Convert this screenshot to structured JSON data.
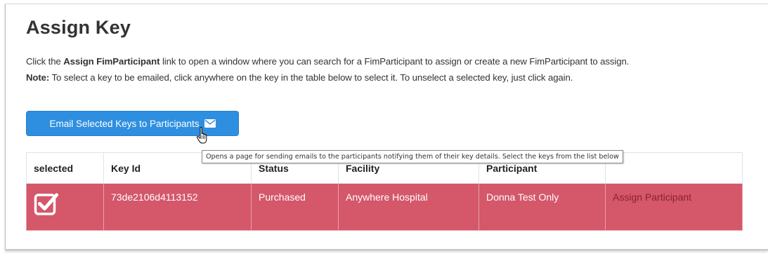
{
  "page": {
    "title": "Assign Key",
    "intro": {
      "prefix": "Click the ",
      "link_label": "Assign FimParticipant",
      "suffix": " link to open a window where you can search for a FimParticipant to assign or create a new FimParticipant to assign."
    },
    "note": {
      "label": "Note:",
      "text": " To select a key to be emailed, click anywhere on the key in the table below to select it. To unselect a selected key, just click again."
    }
  },
  "toolbar": {
    "email_button_label": "Email Selected Keys to Participants",
    "email_icon": "envelope-icon",
    "tooltip": "Opens a page for sending emails to the participants notifying them of their key details. Select the keys from the list below"
  },
  "table": {
    "headers": [
      "selected",
      "Key Id",
      "Status",
      "Facility",
      "Participant",
      ""
    ],
    "rows": [
      {
        "selected": true,
        "key_id": "73de2106d4113152",
        "status": "Purchased",
        "facility": "Anywhere Hospital",
        "participant": "Donna Test Only",
        "action": "Assign Participant"
      }
    ]
  },
  "colors": {
    "primary_button": "#2e8fe0",
    "selected_row": "#d4576a",
    "action_link": "#8c2131"
  }
}
